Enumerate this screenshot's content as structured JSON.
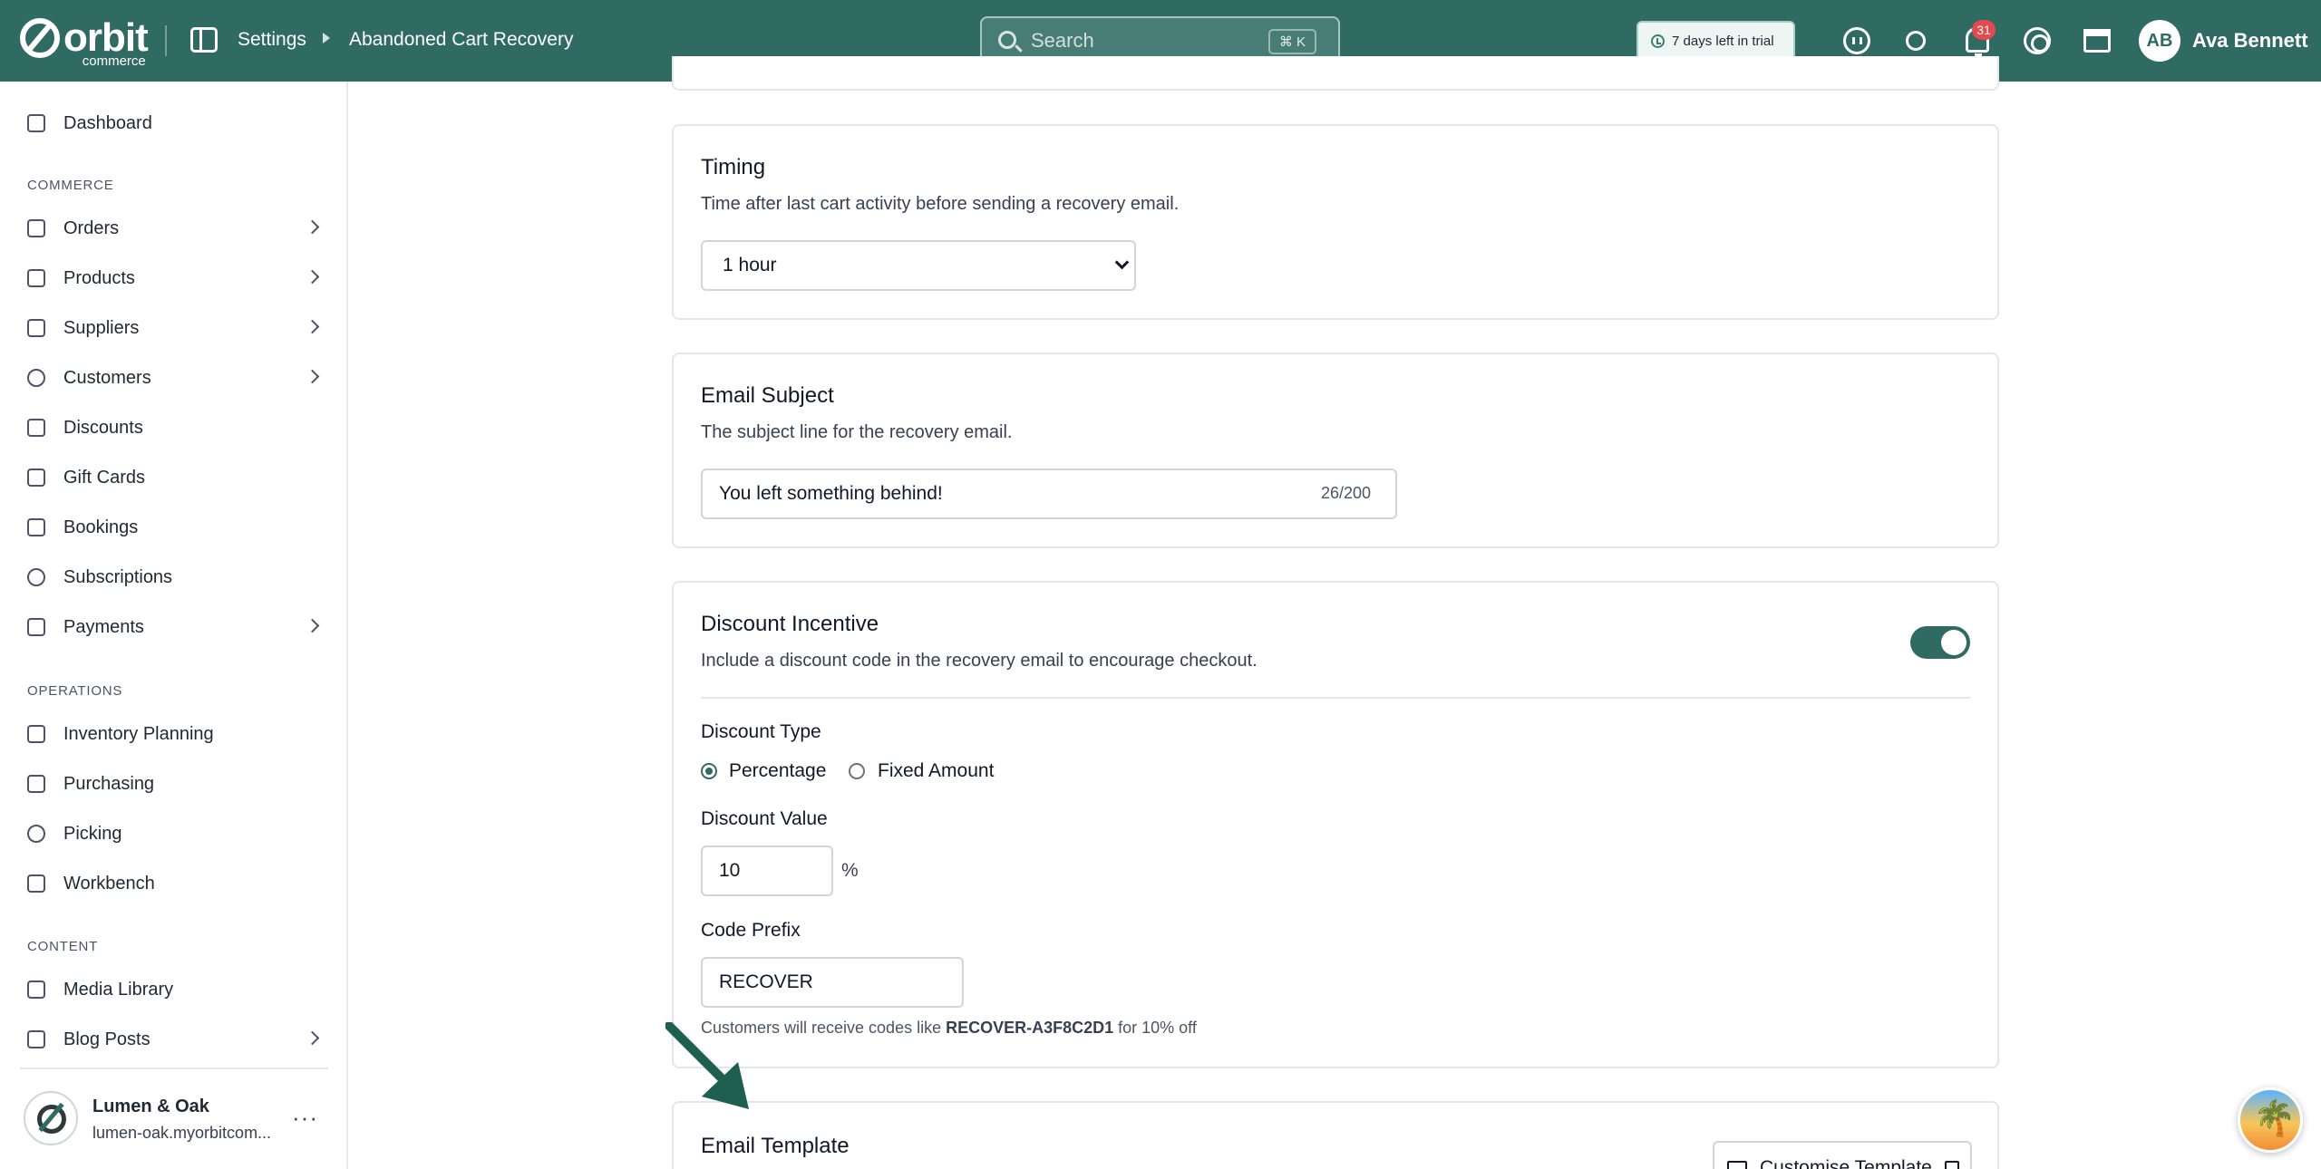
{
  "header": {
    "logo_word": "orbit",
    "logo_sub": "commerce",
    "breadcrumb": [
      "Settings",
      "Abandoned Cart Recovery"
    ],
    "search_placeholder": "Search",
    "search_shortcut": "⌘ K",
    "trial_text": "7 days left in trial",
    "notification_count": "31",
    "user_initials": "AB",
    "user_name": "Ava Bennett",
    "brand_color": "#2f6b62"
  },
  "sidebar": {
    "top_items": [
      {
        "label": "Dashboard",
        "icon": "dashboard-icon",
        "has_chevron": false
      }
    ],
    "sections": [
      {
        "label": "COMMERCE",
        "items": [
          {
            "label": "Orders",
            "icon": "orders-icon",
            "has_chevron": true
          },
          {
            "label": "Products",
            "icon": "box-icon",
            "has_chevron": true
          },
          {
            "label": "Suppliers",
            "icon": "building-icon",
            "has_chevron": true
          },
          {
            "label": "Customers",
            "icon": "users-icon",
            "has_chevron": true
          },
          {
            "label": "Discounts",
            "icon": "tag-icon",
            "has_chevron": false
          },
          {
            "label": "Gift Cards",
            "icon": "gift-icon",
            "has_chevron": false
          },
          {
            "label": "Bookings",
            "icon": "calendar-icon",
            "has_chevron": false
          },
          {
            "label": "Subscriptions",
            "icon": "refresh-icon",
            "has_chevron": false
          },
          {
            "label": "Payments",
            "icon": "credit-card-icon",
            "has_chevron": true
          }
        ]
      },
      {
        "label": "OPERATIONS",
        "items": [
          {
            "label": "Inventory Planning",
            "icon": "clipboard-icon",
            "has_chevron": false
          },
          {
            "label": "Purchasing",
            "icon": "cart-icon",
            "has_chevron": false
          },
          {
            "label": "Picking",
            "icon": "pin-icon",
            "has_chevron": false
          },
          {
            "label": "Workbench",
            "icon": "cube-icon",
            "has_chevron": false
          }
        ]
      },
      {
        "label": "CONTENT",
        "items": [
          {
            "label": "Media Library",
            "icon": "image-icon",
            "has_chevron": false
          },
          {
            "label": "Blog Posts",
            "icon": "document-icon",
            "has_chevron": true
          }
        ]
      }
    ],
    "store": {
      "name": "Lumen & Oak",
      "url": "lumen-oak.myorbitcom..."
    }
  },
  "main": {
    "timing": {
      "title": "Timing",
      "description": "Time after last cart activity before sending a recovery email.",
      "selected": "1 hour"
    },
    "email_subject": {
      "title": "Email Subject",
      "description": "The subject line for the recovery email.",
      "value": "You left something behind!",
      "counter": "26/200"
    },
    "discount": {
      "title": "Discount Incentive",
      "description": "Include a discount code in the recovery email to encourage checkout.",
      "enabled": true,
      "type_label": "Discount Type",
      "option_percentage": "Percentage",
      "option_fixed": "Fixed Amount",
      "value_label": "Discount Value",
      "value": "10",
      "unit": "%",
      "prefix_label": "Code Prefix",
      "prefix_value": "RECOVER",
      "helper_before": "Customers will receive codes like ",
      "helper_code": "RECOVER-A3F8C2D1",
      "helper_after": " for 10% off"
    },
    "email_template": {
      "title": "Email Template",
      "button_label": "Customise Template"
    }
  }
}
